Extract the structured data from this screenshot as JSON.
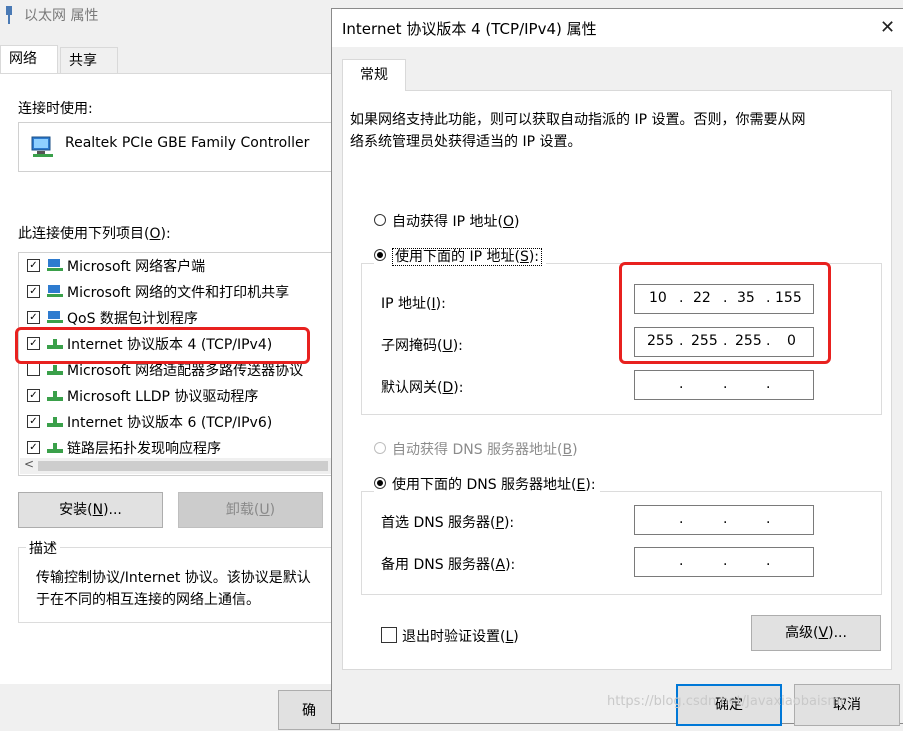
{
  "bg_window": {
    "title": "以太网 属性",
    "tabs": [
      "网络",
      "共享"
    ],
    "connect_using_label": "连接时使用:",
    "adapter_name": "Realtek PCIe GBE Family Controller",
    "items_label": "此连接使用下列项目(O):",
    "items": [
      {
        "label": "Microsoft 网络客户端",
        "checked": true
      },
      {
        "label": "Microsoft 网络的文件和打印机共享",
        "checked": true
      },
      {
        "label": "QoS 数据包计划程序",
        "checked": true
      },
      {
        "label": "Internet 协议版本 4 (TCP/IPv4)",
        "checked": true
      },
      {
        "label": "Microsoft 网络适配器多路传送器协议",
        "checked": false
      },
      {
        "label": "Microsoft LLDP 协议驱动程序",
        "checked": true
      },
      {
        "label": "Internet 协议版本 6 (TCP/IPv6)",
        "checked": true
      },
      {
        "label": "链路层拓扑发现响应程序",
        "checked": true
      }
    ],
    "install_button": "安装(N)...",
    "uninstall_button": "卸载(U)",
    "description_legend": "描述",
    "description_text": "传输控制协议/Internet 协议。该协议是默认于在不同的相互连接的网络上通信。",
    "description_line1": "传输控制协议/Internet 协议。该协议是默认",
    "description_line2": "于在不同的相互连接的网络上通信。",
    "ok_partial": "确"
  },
  "dialog": {
    "title": "Internet 协议版本 4 (TCP/IPv4) 属性",
    "close_glyph": "✕",
    "tab": "常规",
    "intro_line1": "如果网络支持此功能，则可以获取自动指派的 IP 设置。否则，你需要从网",
    "intro_line2": "络系统管理员处获得适当的 IP 设置。",
    "auto_ip": "自动获得 IP 地址(O)",
    "manual_ip": "使用下面的 IP 地址(S):",
    "ip_label": "IP 地址(I):",
    "mask_label": "子网掩码(U):",
    "gateway_label": "默认网关(D):",
    "ip_octets": [
      "10",
      "22",
      "35",
      "155"
    ],
    "mask_octets": [
      "255",
      "255",
      "255",
      "0"
    ],
    "gateway_octets": [
      "",
      "",
      "",
      ""
    ],
    "auto_dns": "自动获得 DNS 服务器地址(B)",
    "manual_dns": "使用下面的 DNS 服务器地址(E):",
    "dns1_label": "首选 DNS 服务器(P):",
    "dns2_label": "备用 DNS 服务器(A):",
    "dns1_octets": [
      "",
      "",
      "",
      ""
    ],
    "dns2_octets": [
      "",
      "",
      "",
      ""
    ],
    "validate_label": "退出时验证设置(L)",
    "advanced_button": "高级(V)...",
    "ok_button": "确定",
    "cancel_button": "取消"
  },
  "watermark": "https://blog.csdn.net/Javaxiaobaismc",
  "colors": {
    "highlight_red": "#e8211f",
    "accent_blue": "#0078d7"
  }
}
